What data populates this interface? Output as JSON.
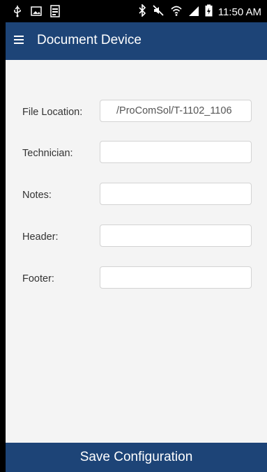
{
  "status_bar": {
    "time": "11:50 AM",
    "left_icons": [
      "usb-icon",
      "image-icon",
      "document-icon"
    ],
    "right_icons": [
      "bluetooth-icon",
      "mute-icon",
      "wifi-icon",
      "signal-icon",
      "battery-charging-icon"
    ]
  },
  "app_bar": {
    "title": "Document Device",
    "menu_icon": "menu-icon"
  },
  "form": {
    "file_location": {
      "label": "File Location:",
      "value": "/ProComSol/T-1102_1106"
    },
    "technician": {
      "label": "Technician:",
      "value": ""
    },
    "notes": {
      "label": "Notes:",
      "value": ""
    },
    "header": {
      "label": "Header:",
      "value": ""
    },
    "footer": {
      "label": "Footer:",
      "value": ""
    }
  },
  "save_button": {
    "label": "Save Configuration"
  },
  "colors": {
    "primary": "#1d4477",
    "background": "#f4f4f4",
    "status_bar": "#000000"
  }
}
